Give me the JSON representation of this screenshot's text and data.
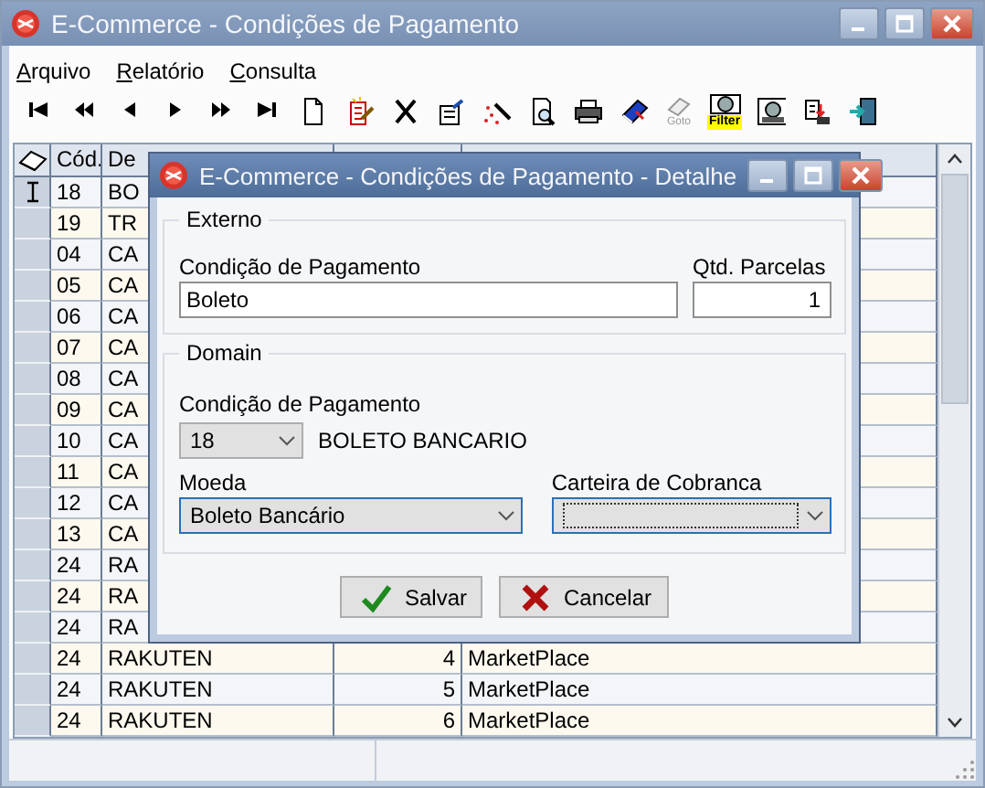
{
  "window": {
    "title": "E-Commerce - Condições de Pagamento"
  },
  "menu": [
    {
      "label": "Arquivo",
      "underline_first": true
    },
    {
      "label": "Relatório",
      "underline_first": true
    },
    {
      "label": "Consulta",
      "underline_first": true
    }
  ],
  "toolbar": [
    {
      "kind": "first"
    },
    {
      "kind": "prev-page"
    },
    {
      "kind": "prev"
    },
    {
      "kind": "next"
    },
    {
      "kind": "next-page"
    },
    {
      "kind": "last"
    },
    {
      "kind": "new"
    },
    {
      "kind": "edit"
    },
    {
      "kind": "delete"
    },
    {
      "kind": "form"
    },
    {
      "kind": "wand"
    },
    {
      "kind": "preview"
    },
    {
      "kind": "print"
    },
    {
      "kind": "book"
    },
    {
      "kind": "goto",
      "label": "Goto"
    },
    {
      "kind": "filter",
      "label": "Filter"
    },
    {
      "kind": "monitor"
    },
    {
      "kind": "export"
    },
    {
      "kind": "exit"
    }
  ],
  "grid": {
    "columns": [
      {
        "label": "Cód."
      },
      {
        "label": "De"
      }
    ],
    "rows": [
      {
        "code": "18",
        "description": "BO",
        "indicator": true
      },
      {
        "code": "19",
        "description": "TR",
        "indicator": false
      },
      {
        "code": "04",
        "description": "CA",
        "indicator": false
      },
      {
        "code": "05",
        "description": "CA",
        "indicator": false
      },
      {
        "code": "06",
        "description": "CA",
        "indicator": false
      },
      {
        "code": "07",
        "description": "CA",
        "indicator": false
      },
      {
        "code": "08",
        "description": "CA",
        "indicator": false
      },
      {
        "code": "09",
        "description": "CA",
        "indicator": false
      },
      {
        "code": "10",
        "description": "CA",
        "indicator": false
      },
      {
        "code": "11",
        "description": "CA",
        "indicator": false
      },
      {
        "code": "12",
        "description": "CA",
        "indicator": false
      },
      {
        "code": "13",
        "description": "CA",
        "indicator": false
      },
      {
        "code": "24",
        "description": "RA",
        "indicator": false
      },
      {
        "code": "24",
        "description": "RA",
        "indicator": false
      },
      {
        "code": "24",
        "description": "RA",
        "indicator": false
      },
      {
        "code": "24",
        "description": "RAKUTEN",
        "column_3": "4",
        "column_4": "MarketPlace",
        "indicator": false
      },
      {
        "code": "24",
        "description": "RAKUTEN",
        "column_3": "5",
        "column_4": "MarketPlace",
        "indicator": false
      },
      {
        "code": "24",
        "description": "RAKUTEN",
        "column_3": "6",
        "column_4": "MarketPlace",
        "indicator": false
      }
    ]
  },
  "dialog": {
    "title": "E-Commerce - Condições de Pagamento - Detalhe",
    "external": {
      "legend": "Externo",
      "condition_label": "Condição de Pagamento",
      "condition_value": "Boleto",
      "installments_label": "Qtd. Parcelas",
      "installments_value": "1"
    },
    "domain": {
      "legend": "Domain",
      "condition_label": "Condição de Pagamento",
      "condition_code": "18",
      "condition_name": "BOLETO BANCARIO",
      "currency_label": "Moeda",
      "currency_value": "Boleto Bancário",
      "wallet_label": "Carteira de Cobranca",
      "wallet_focused": true
    },
    "buttons": [
      {
        "kind": "save",
        "label": "Salvar"
      },
      {
        "kind": "cancel",
        "label": "Cancelar"
      }
    ]
  }
}
